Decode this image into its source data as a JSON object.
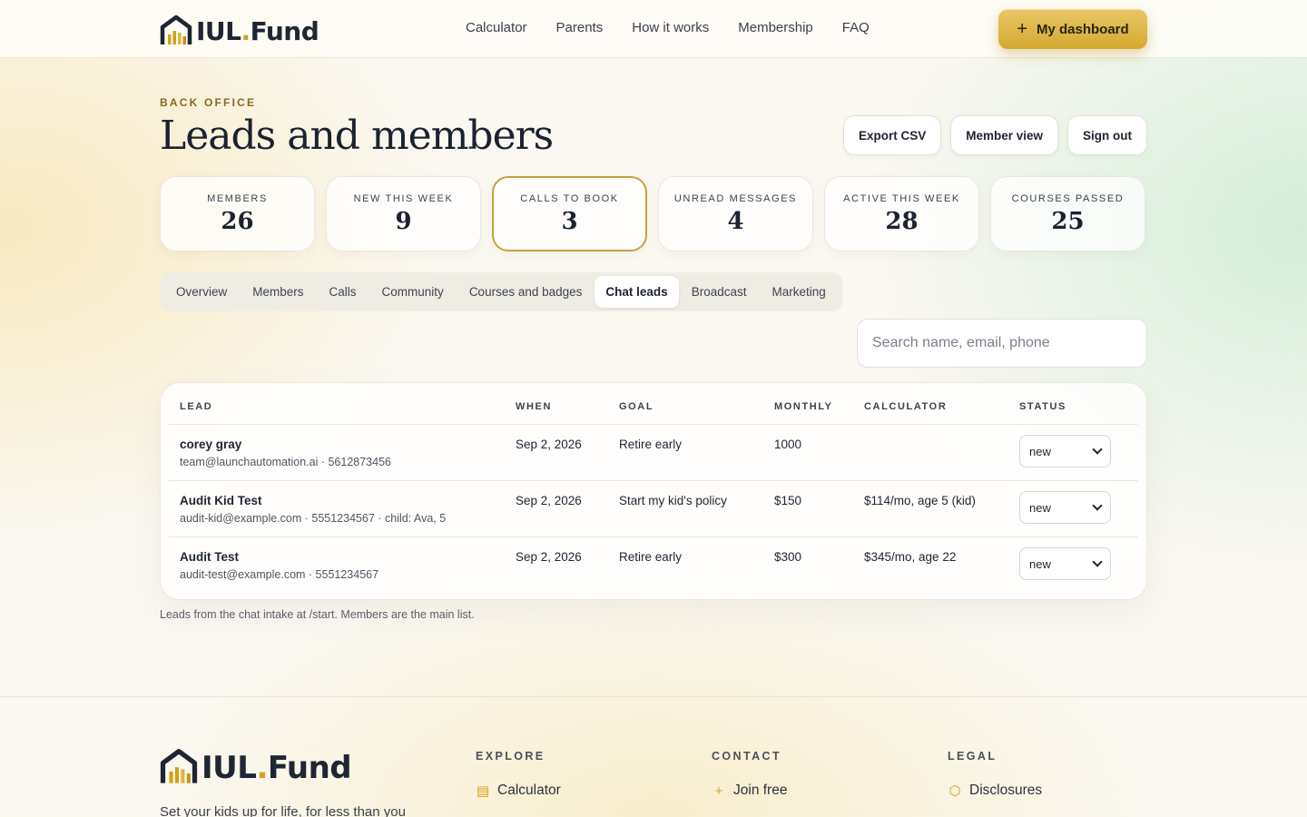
{
  "nav": {
    "brand": {
      "main": "IUL",
      "dot": ".",
      "rest": "Fund"
    },
    "links": [
      "Calculator",
      "Parents",
      "How it works",
      "Membership",
      "FAQ"
    ],
    "dashboard_label": "My dashboard"
  },
  "header": {
    "eyebrow": "BACK OFFICE",
    "title": "Leads and members",
    "actions": [
      "Export CSV",
      "Member view",
      "Sign out"
    ]
  },
  "stats": [
    {
      "label": "MEMBERS",
      "value": "26"
    },
    {
      "label": "NEW THIS WEEK",
      "value": "9"
    },
    {
      "label": "CALLS TO BOOK",
      "value": "3"
    },
    {
      "label": "UNREAD MESSAGES",
      "value": "4"
    },
    {
      "label": "ACTIVE THIS WEEK",
      "value": "28"
    },
    {
      "label": "COURSES PASSED",
      "value": "25"
    }
  ],
  "tabs": [
    "Overview",
    "Members",
    "Calls",
    "Community",
    "Courses and badges",
    "Chat leads",
    "Broadcast",
    "Marketing"
  ],
  "active_tab": "Chat leads",
  "search": {
    "placeholder": "Search name, email, phone",
    "value": ""
  },
  "table": {
    "columns": [
      "LEAD",
      "WHEN",
      "GOAL",
      "MONTHLY",
      "CALCULATOR",
      "STATUS"
    ],
    "rows": [
      {
        "name": "corey gray",
        "sub": "team@launchautomation.ai · 5612873456",
        "when": "Sep 2, 2026",
        "goal": "Retire early",
        "monthly": "1000",
        "calculator": "",
        "status": "new"
      },
      {
        "name": "Audit Kid Test",
        "sub": "audit-kid@example.com · 5551234567 · child: Ava, 5",
        "when": "Sep 2, 2026",
        "goal": "Start my kid's policy",
        "monthly": "$150",
        "calculator": "$114/mo, age 5 (kid)",
        "status": "new"
      },
      {
        "name": "Audit Test",
        "sub": "audit-test@example.com · 5551234567",
        "when": "Sep 2, 2026",
        "goal": "Retire early",
        "monthly": "$300",
        "calculator": "$345/mo, age 22",
        "status": "new"
      }
    ]
  },
  "note": "Leads from the chat intake at /start. Members are the main list.",
  "footer": {
    "tagline": "Set your kids up for life, for less than you",
    "columns": [
      {
        "heading": "EXPLORE",
        "link": "Calculator",
        "icon": "calculator-icon"
      },
      {
        "heading": "CONTACT",
        "link": "Join free",
        "icon": "plus-icon"
      },
      {
        "heading": "LEGAL",
        "link": "Disclosures",
        "icon": "shield-icon"
      }
    ]
  },
  "colors": {
    "accent": "#d4a017",
    "highlight_border": "#c9a23e",
    "text": "#1b2230"
  }
}
